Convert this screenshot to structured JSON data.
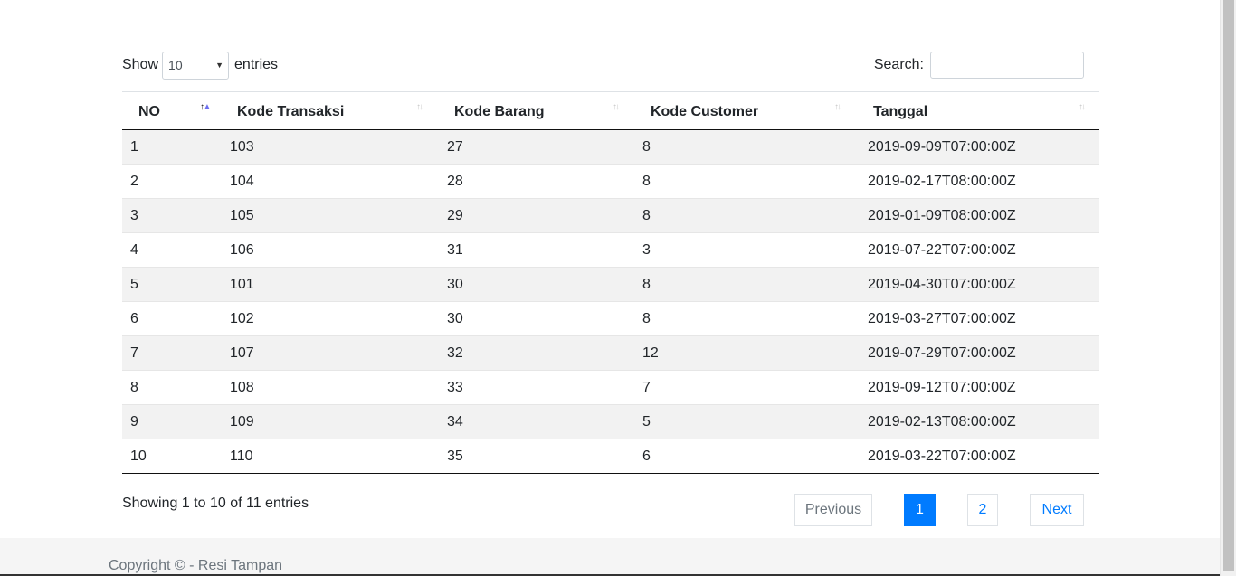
{
  "length": {
    "show_label": "Show",
    "selected": "10",
    "entries_label": "entries"
  },
  "search": {
    "label": "Search:",
    "value": "",
    "placeholder": ""
  },
  "table": {
    "headers": [
      "NO",
      "Kode Transaksi",
      "Kode Barang",
      "Kode Customer",
      "Tanggal"
    ],
    "rows": [
      [
        "1",
        "103",
        "27",
        "8",
        "2019-09-09T07:00:00Z"
      ],
      [
        "2",
        "104",
        "28",
        "8",
        "2019-02-17T08:00:00Z"
      ],
      [
        "3",
        "105",
        "29",
        "8",
        "2019-01-09T08:00:00Z"
      ],
      [
        "4",
        "106",
        "31",
        "3",
        "2019-07-22T07:00:00Z"
      ],
      [
        "5",
        "101",
        "30",
        "8",
        "2019-04-30T07:00:00Z"
      ],
      [
        "6",
        "102",
        "30",
        "8",
        "2019-03-27T07:00:00Z"
      ],
      [
        "7",
        "107",
        "32",
        "12",
        "2019-07-29T07:00:00Z"
      ],
      [
        "8",
        "108",
        "33",
        "7",
        "2019-09-12T07:00:00Z"
      ],
      [
        "9",
        "109",
        "34",
        "5",
        "2019-02-13T08:00:00Z"
      ],
      [
        "10",
        "110",
        "35",
        "6",
        "2019-03-22T07:00:00Z"
      ]
    ]
  },
  "info": "Showing 1 to 10 of 11 entries",
  "pagination": {
    "previous": "Previous",
    "pages": [
      "1",
      "2"
    ],
    "current": "1",
    "next": "Next"
  },
  "footer": {
    "copyright": "Copyright © - Resi Tampan"
  },
  "colors": {
    "accent": "#007bff",
    "stripe": "#f2f2f2",
    "footer_bg": "#f5f5f5"
  }
}
